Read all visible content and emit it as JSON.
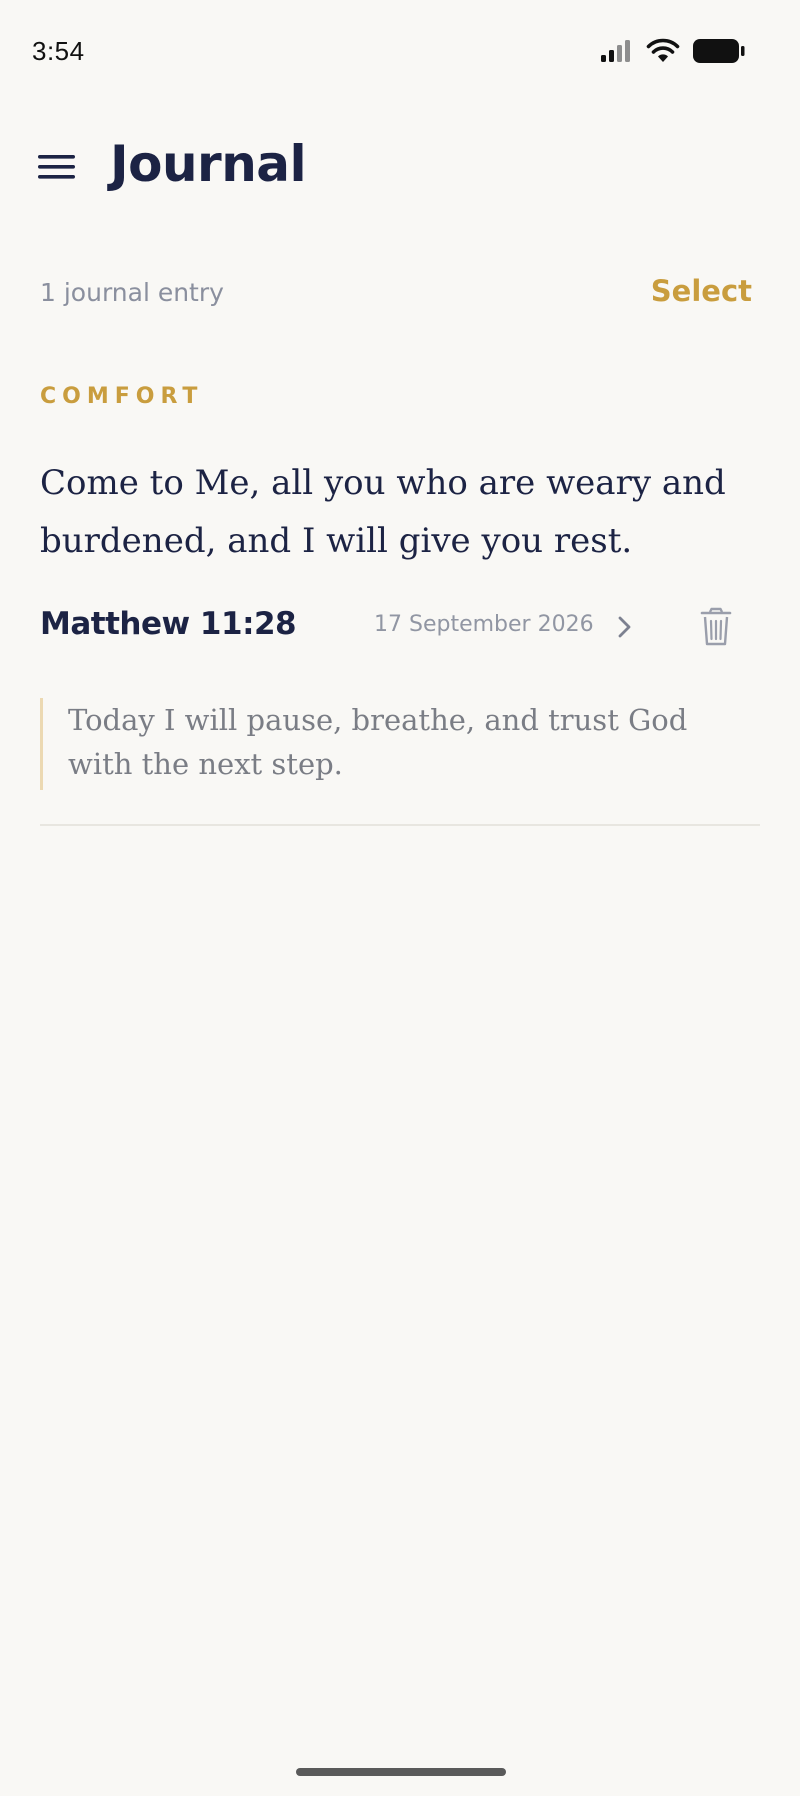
{
  "status_bar": {
    "time": "3:54"
  },
  "header": {
    "title": "Journal"
  },
  "toolbar": {
    "entry_count": "1 journal entry",
    "select_label": "Select"
  },
  "entries": [
    {
      "category": "COMFORT",
      "verse": "Come to Me, all you who are weary and burdened, and I will give you rest.",
      "reference": "Matthew 11:28",
      "date": "17 September 2026",
      "note": "Today I will pause, breathe, and trust God with the next step."
    }
  ],
  "icons": {
    "menu": "hamburger-menu-icon",
    "chevron": "chevron-right-icon",
    "delete": "trash-icon",
    "signal": "cellular-signal-icon",
    "wifi": "wifi-icon",
    "battery": "battery-icon"
  },
  "colors": {
    "background": "#f9f8f5",
    "primary_text": "#1c2344",
    "accent": "#c99d3e",
    "muted_text": "#8a8f9e",
    "note_border": "#ecd9b2"
  }
}
